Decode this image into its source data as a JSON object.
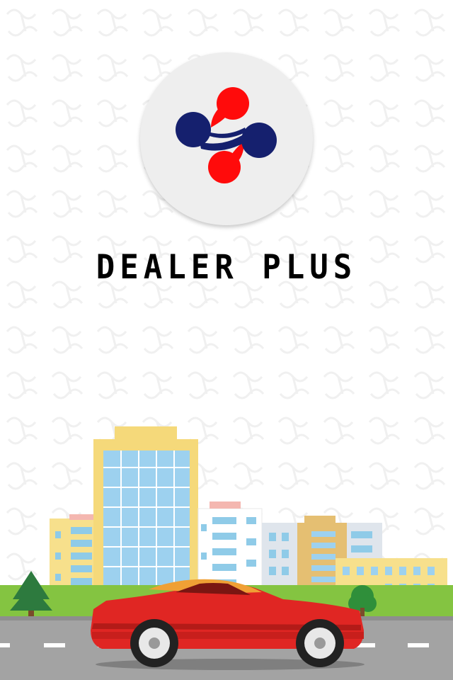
{
  "app": {
    "title": "DEALER PLUS",
    "logo_icon": "dealer-plus-logo-icon"
  },
  "colors": {
    "logo_red": "#ff0b0b",
    "logo_navy": "#15206e",
    "car_red": "#e02623",
    "road": "#a3a3a3",
    "grass": "#84c441"
  },
  "scene": {
    "illustration": "city-street-with-red-car-illustration"
  }
}
